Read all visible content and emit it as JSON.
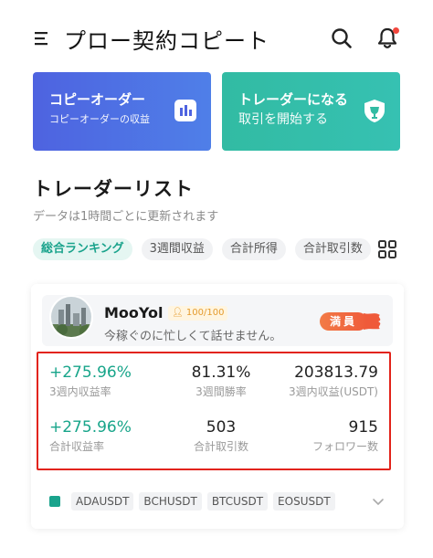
{
  "header": {
    "title": "プロー契約コピート",
    "menu_icon": "menu-icon",
    "search_icon": "search-icon",
    "bell_icon": "bell-icon"
  },
  "banners": [
    {
      "title": "コピーオーダー",
      "subtitle": "コピーオーダーの収益",
      "icon": "chart-doc-icon",
      "color": "#4e63e0"
    },
    {
      "title": "トレーダーになる",
      "subtitle": "取引を開始する",
      "icon": "shield-trophy-icon",
      "color": "#32bba3"
    }
  ],
  "section": {
    "title": "トレーダーリスト",
    "subtitle": "データは1時間ごとに更新されます"
  },
  "tabs": [
    {
      "label": "総合ランキング",
      "active": true
    },
    {
      "label": "3週間収益",
      "active": false
    },
    {
      "label": "合計所得",
      "active": false
    },
    {
      "label": "合計取引数",
      "active": false
    }
  ],
  "trader": {
    "username": "MooYol",
    "score": "100/100",
    "bio": "今稼ぐのに忙しくて話せません。",
    "status": "満員",
    "stats": {
      "return_3w": {
        "value": "+275.96%",
        "label": "3週内収益率"
      },
      "winrate_3w": {
        "value": "81.31%",
        "label": "3週間勝率"
      },
      "profit_3w": {
        "value": "203813.79",
        "label": "3週内収益(USDT)"
      },
      "return_total": {
        "value": "+275.96%",
        "label": "合計収益率"
      },
      "trades_total": {
        "value": "503",
        "label": "合計取引数"
      },
      "followers": {
        "value": "915",
        "label": "フォロワー数"
      }
    },
    "coins": [
      "ADAUSDT",
      "BCHUSDT",
      "BTCUSDT",
      "EOSUSDT"
    ]
  },
  "colors": {
    "accent_green": "#18a58a",
    "highlight_border": "#e2231a",
    "badge_orange": "#ef5a3a"
  }
}
